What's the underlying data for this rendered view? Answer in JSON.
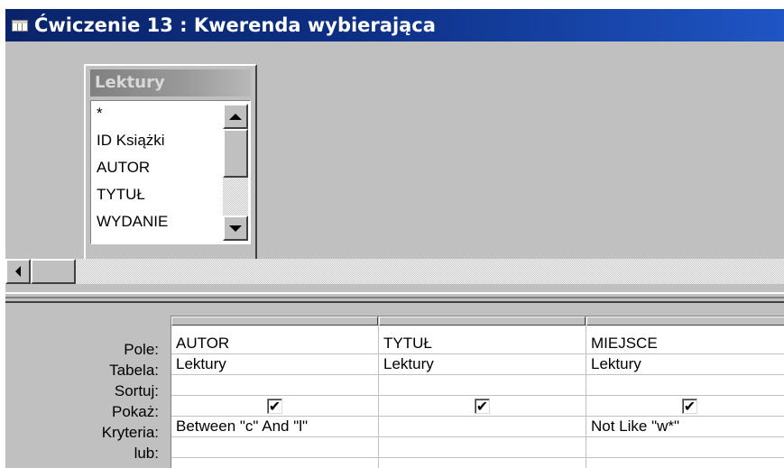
{
  "window": {
    "title": "Ćwiczenie 13 : Kwerenda wybierająca",
    "icon": "query-datasheet-icon"
  },
  "table_box": {
    "title": "Lektury",
    "fields": [
      "*",
      "ID Książki",
      "AUTOR",
      "TYTUŁ",
      "WYDANIE"
    ]
  },
  "grid": {
    "row_labels": {
      "field": "Pole:",
      "table": "Tabela:",
      "sort": "Sortuj:",
      "show": "Pokaż:",
      "criteria": "Kryteria:",
      "or": "lub:"
    },
    "columns": [
      {
        "field": "AUTOR",
        "table": "Lektury",
        "sort": "",
        "show": true,
        "show_mark": "✔",
        "criteria": "Between \"c\" And \"l\"",
        "or": ""
      },
      {
        "field": "TYTUŁ",
        "table": "Lektury",
        "sort": "",
        "show": true,
        "show_mark": "✔",
        "criteria": "",
        "or": ""
      },
      {
        "field": "MIEJSCE",
        "table": "Lektury",
        "sort": "",
        "show": true,
        "show_mark": "✔",
        "criteria": "Not Like \"w*\"",
        "or": ""
      }
    ]
  }
}
